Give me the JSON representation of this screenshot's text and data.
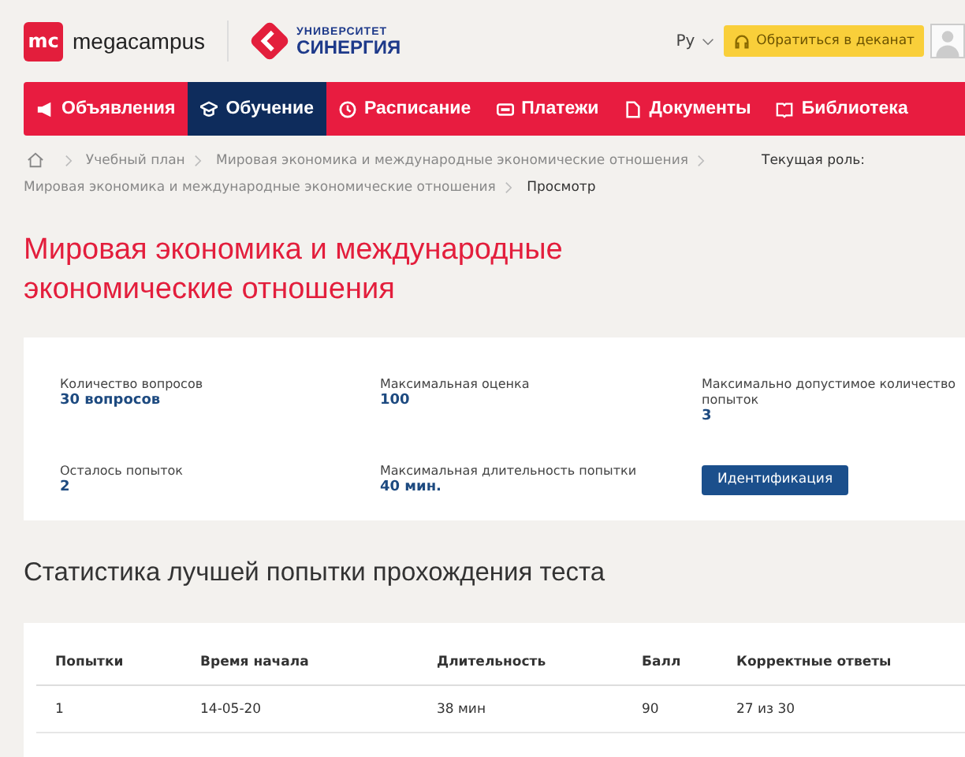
{
  "header": {
    "brand_mark": "mc",
    "brand_name": "megacampus",
    "university_top": "УНИВЕРСИТЕТ",
    "university_name": "СИНЕРГИЯ",
    "language": "Ру",
    "contact_button": "Обратиться в деканат"
  },
  "nav": [
    {
      "label": "Объявления",
      "kind": "megaphone",
      "selected": false
    },
    {
      "label": "Обучение",
      "kind": "cap",
      "selected": true
    },
    {
      "label": "Расписание",
      "kind": "clock",
      "selected": false
    },
    {
      "label": "Платежи",
      "kind": "card",
      "selected": false
    },
    {
      "label": "Документы",
      "kind": "doc",
      "selected": false
    },
    {
      "label": "Библиотека",
      "kind": "book",
      "selected": false
    }
  ],
  "breadcrumbs": [
    "Учебный план",
    "Мировая экономика и международные экономические отношения",
    "Мировая экономика и международные экономические отношения",
    "Просмотр"
  ],
  "current_role_label": "Текущая роль:",
  "title": "Мировая экономика и международные экономические отношения",
  "info": [
    {
      "label": "Количество вопросов",
      "value": "30 вопросов"
    },
    {
      "label": "Максимальная оценка",
      "value": "100"
    },
    {
      "label": "Максимально допустимое количество попыток",
      "value": "3"
    },
    {
      "label": "Осталось попыток",
      "value": "2"
    },
    {
      "label": "Максимальная длительность попытки",
      "value": "40 мин."
    }
  ],
  "identify_button": "Идентификация",
  "stats_title": "Статистика лучшей попытки прохождения теста",
  "table": {
    "columns": [
      "Попытки",
      "Время начала",
      "Длительность",
      "Балл",
      "Корректные ответы"
    ],
    "rows": [
      [
        "1",
        "14-05-20",
        "38 мин",
        "90",
        "27 из 30"
      ]
    ]
  }
}
